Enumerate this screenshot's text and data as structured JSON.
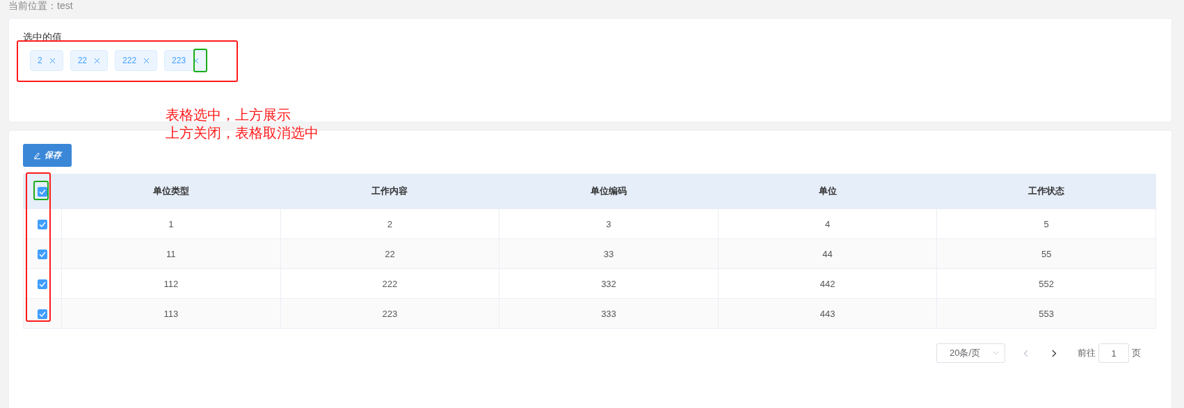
{
  "breadcrumb": "当前位置：test",
  "selected_panel": {
    "title": "选中的值",
    "tags": [
      {
        "label": "2"
      },
      {
        "label": "22"
      },
      {
        "label": "222"
      },
      {
        "label": "223"
      }
    ]
  },
  "note_lines": [
    "表格选中，上方展示",
    "上方关闭，表格取消选中"
  ],
  "highlights": [
    {
      "kind": "tag-list",
      "color": "#ff1a1a"
    },
    {
      "kind": "tag-close",
      "color": "#1aad19"
    },
    {
      "kind": "checkbox-column",
      "color": "#ff1a1a"
    },
    {
      "kind": "header-checkbox",
      "color": "#1aad19"
    }
  ],
  "save_button": "保存",
  "table": {
    "all_checked": true,
    "columns": [
      "单位类型",
      "工作内容",
      "单位编码",
      "单位",
      "工作状态"
    ],
    "rows": [
      {
        "checked": true,
        "cells": [
          "1",
          "2",
          "3",
          "4",
          "5"
        ]
      },
      {
        "checked": true,
        "cells": [
          "11",
          "22",
          "33",
          "44",
          "55"
        ]
      },
      {
        "checked": true,
        "cells": [
          "112",
          "222",
          "332",
          "442",
          "552"
        ]
      },
      {
        "checked": true,
        "cells": [
          "113",
          "223",
          "333",
          "443",
          "553"
        ]
      }
    ]
  },
  "pagination": {
    "page_size": "20条/页",
    "prev_disabled": true,
    "goto_label": "前往",
    "page": "1",
    "page_suffix": "页"
  }
}
